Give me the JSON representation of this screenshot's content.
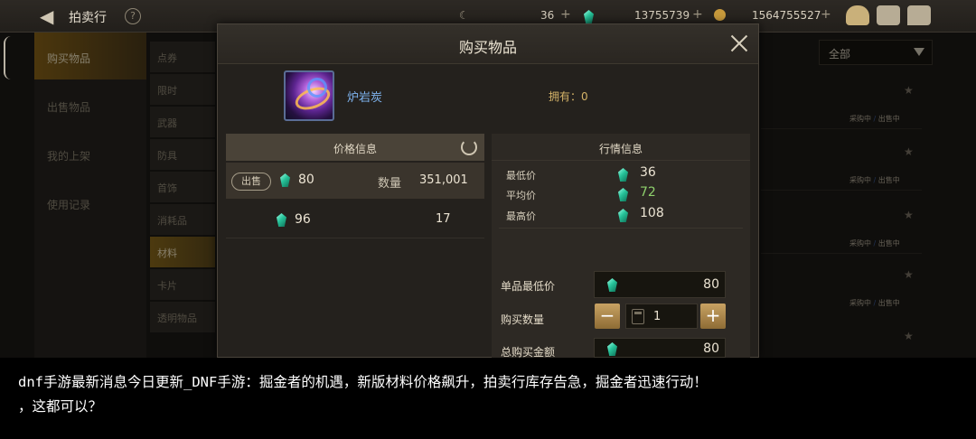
{
  "topbar": {
    "title": "拍卖行",
    "help_icon": "question-icon",
    "currency1_value": "36",
    "currency2_value": "13755739",
    "currency3_value": "1564755527",
    "plus": "+"
  },
  "left_nav": {
    "items": [
      {
        "label": "购买物品",
        "active": true
      },
      {
        "label": "出售物品",
        "active": false
      },
      {
        "label": "我的上架",
        "active": false
      },
      {
        "label": "使用记录",
        "active": false
      }
    ]
  },
  "category_nav": {
    "items": [
      {
        "label": "点券",
        "active": false
      },
      {
        "label": "限时",
        "active": false
      },
      {
        "label": "武器",
        "active": false
      },
      {
        "label": "防具",
        "active": false
      },
      {
        "label": "首饰",
        "active": false
      },
      {
        "label": "消耗品",
        "active": false
      },
      {
        "label": "材料",
        "active": true
      },
      {
        "label": "卡片",
        "active": false
      },
      {
        "label": "透明物品",
        "active": false
      }
    ]
  },
  "list_filter": {
    "selected": "全部"
  },
  "list_rows": [
    {
      "status_a": "采购中",
      "status_b": "出售中"
    },
    {
      "status_a": "采购中",
      "status_b": "出售中"
    },
    {
      "status_a": "采购中",
      "status_b": "出售中"
    },
    {
      "status_a": "采购中",
      "status_b": "出售中"
    }
  ],
  "dialog": {
    "title": "购买物品",
    "item_name": "炉岩炭",
    "owned": "拥有：0",
    "price_info": {
      "header": "价格信息",
      "rows": [
        {
          "badge": "出售",
          "price": "80",
          "qty_label": "数量",
          "qty": "351,001"
        },
        {
          "price": "96",
          "qty": "17"
        }
      ]
    },
    "market_info": {
      "header": "行情信息",
      "min_label": "最低价",
      "min_value": "36",
      "avg_label": "平均价",
      "avg_value": "72",
      "max_label": "最高价",
      "max_value": "108"
    },
    "form": {
      "unit_price_label": "单品最低价",
      "unit_price": "80",
      "buy_qty_label": "购买数量",
      "buy_qty": "1",
      "minus": "−",
      "plus": "+",
      "total_label": "总购买金额",
      "total": "80"
    }
  },
  "caption": {
    "line1": "dnf手游最新消息今日更新_DNF手游：掘金者的机遇，新版材料价格飙升，拍卖行库存告急，掘金者迅速行动！",
    "line2": "，这都可以？"
  },
  "colors": {
    "accent_gold": "#8c6a1c",
    "gem_green": "#27c39a",
    "item_name_blue": "#7eb3ee",
    "avg_green": "#8ed06c"
  }
}
